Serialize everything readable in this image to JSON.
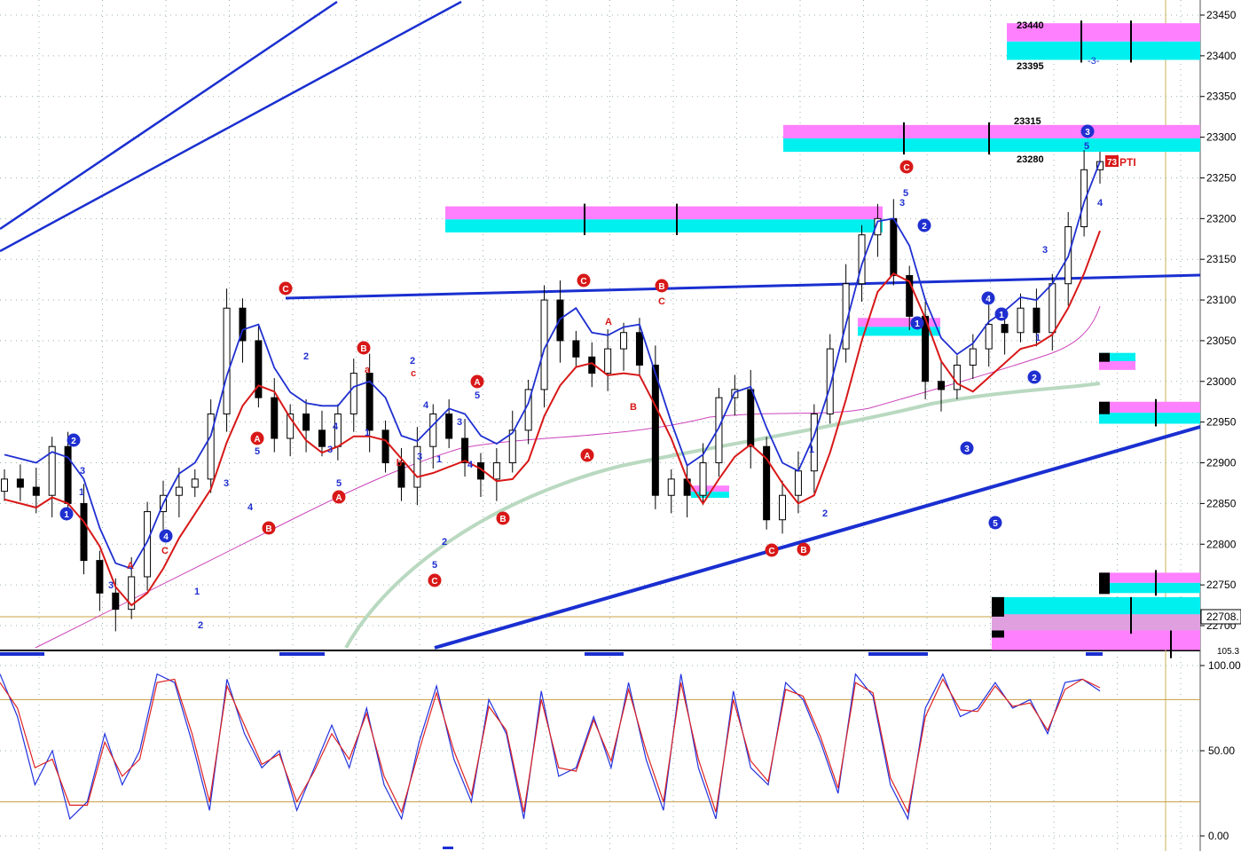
{
  "chart_data": [
    {
      "type": "candlestick",
      "title": "",
      "ylim": [
        22700,
        23460
      ],
      "y_ticks": [
        "23450",
        "23400",
        "23350",
        "23300",
        "23250",
        "23200",
        "23150",
        "23100",
        "23050",
        "23000",
        "22950",
        "22900",
        "22850",
        "22800",
        "22750",
        "22700"
      ],
      "current_price_label": "22708.",
      "zone_labels": [
        "23440",
        "23395",
        "23315",
        "23280"
      ],
      "pti_label": "PTI",
      "pti_value": "73",
      "wave_labels": [
        "1",
        "2",
        "3",
        "4",
        "5",
        "A",
        "B",
        "C",
        "a",
        "b",
        "c"
      ],
      "grid": true,
      "colors": {
        "up_candle": "#ffffff",
        "down_candle": "#000000",
        "blue_wave": "#1f2fd0",
        "red_line": "#d81818",
        "ma_green": "#b9d9c0",
        "ma_magenta": "#cc44bb",
        "zone_magenta": "#ff80ff",
        "zone_cyan": "#00f0f0",
        "trendline": "#1a2fd0"
      },
      "series": [
        {
          "name": "",
          "values": [
            22880,
            22870,
            22860,
            22920,
            22850,
            22780,
            22740,
            22720,
            22760,
            22840,
            22860,
            22870,
            22880,
            22960,
            23090,
            23050,
            22980,
            22930,
            22960,
            22940,
            22920,
            22960,
            23010,
            22940,
            22900,
            22870,
            22920,
            22960,
            22930,
            22900,
            22880,
            22900,
            22940,
            22990,
            23100,
            23050,
            23030,
            23010,
            23040,
            23060,
            23020,
            22860,
            22880,
            22860,
            22900,
            22980,
            22990,
            22920,
            22830,
            22860,
            22890,
            22960,
            23040,
            23120,
            23180,
            23200,
            23130,
            23080,
            23000,
            22990,
            23020,
            23040,
            23070,
            23060,
            23090,
            23060,
            23120,
            23190,
            23260,
            23270
          ]
        }
      ]
    },
    {
      "type": "line",
      "title": "",
      "ylim": [
        0,
        100
      ],
      "y_ticks": [
        "100.00",
        "50.00",
        "0.00"
      ],
      "top_label": "105.3",
      "reference_levels": [
        80,
        20
      ],
      "colors": {
        "k": "#2233dd",
        "d": "#dd2222"
      },
      "series": [
        {
          "name": "",
          "values": [
            95,
            70,
            30,
            50,
            10,
            20,
            60,
            30,
            50,
            95,
            90,
            55,
            15,
            92,
            60,
            40,
            50,
            15,
            40,
            65,
            40,
            75,
            30,
            10,
            55,
            88,
            45,
            20,
            80,
            60,
            10,
            85,
            35,
            40,
            70,
            40,
            90,
            45,
            15,
            95,
            40,
            10,
            85,
            40,
            30,
            90,
            80,
            55,
            25,
            95,
            82,
            30,
            10,
            75,
            95,
            70,
            75,
            90,
            75,
            80,
            60,
            90,
            92,
            85
          ]
        },
        {
          "name": "",
          "values": [
            90,
            75,
            40,
            45,
            18,
            18,
            55,
            35,
            45,
            90,
            92,
            60,
            20,
            88,
            65,
            42,
            48,
            20,
            38,
            60,
            45,
            72,
            35,
            14,
            50,
            84,
            50,
            24,
            76,
            62,
            14,
            80,
            40,
            38,
            68,
            44,
            86,
            50,
            20,
            90,
            45,
            14,
            80,
            44,
            32,
            86,
            82,
            58,
            28,
            90,
            84,
            34,
            14,
            70,
            92,
            74,
            73,
            88,
            76,
            78,
            62,
            86,
            92,
            87
          ]
        }
      ]
    }
  ]
}
